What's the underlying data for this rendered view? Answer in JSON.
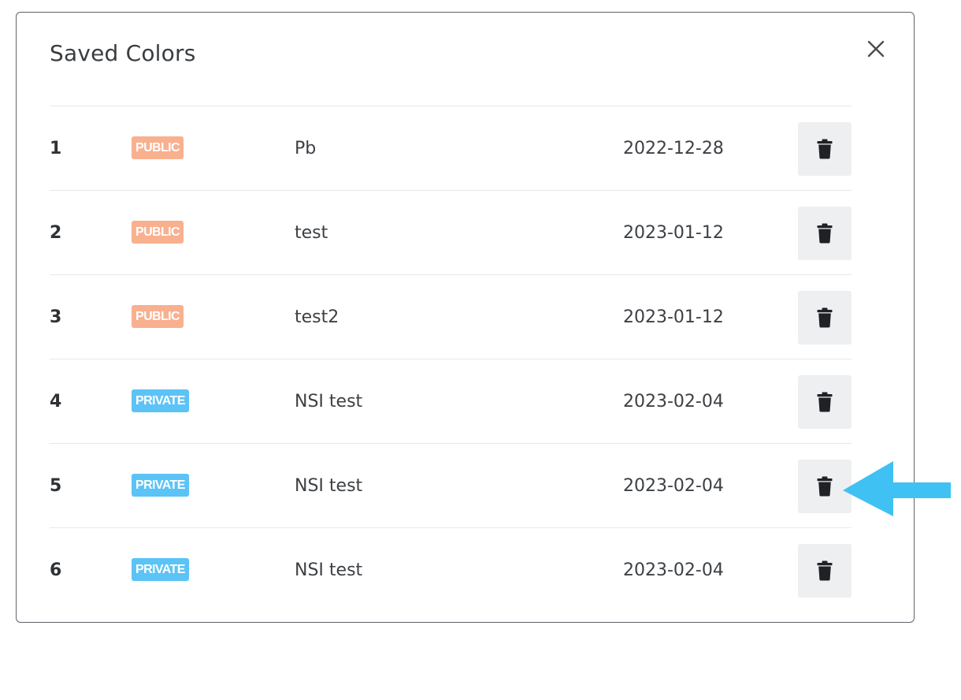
{
  "dialog": {
    "title": "Saved Colors",
    "close_icon": "close-x-icon"
  },
  "colors": [
    {
      "index": "1",
      "visibility": "PUBLIC",
      "name": "Pb",
      "date": "2022-12-28"
    },
    {
      "index": "2",
      "visibility": "PUBLIC",
      "name": "test",
      "date": "2023-01-12"
    },
    {
      "index": "3",
      "visibility": "PUBLIC",
      "name": "test2",
      "date": "2023-01-12"
    },
    {
      "index": "4",
      "visibility": "PRIVATE",
      "name": "NSI test",
      "date": "2023-02-04"
    },
    {
      "index": "5",
      "visibility": "PRIVATE",
      "name": "NSI test",
      "date": "2023-02-04"
    },
    {
      "index": "6",
      "visibility": "PRIVATE",
      "name": "NSI test",
      "date": "2023-02-04"
    }
  ],
  "delete_icon": "trash-icon",
  "badge_colors": {
    "public": "#f9b08e",
    "private": "#5cc3f6"
  },
  "annotation": {
    "icon": "left-arrow-icon",
    "color": "#3fc1f3",
    "points_to_row": "5"
  }
}
